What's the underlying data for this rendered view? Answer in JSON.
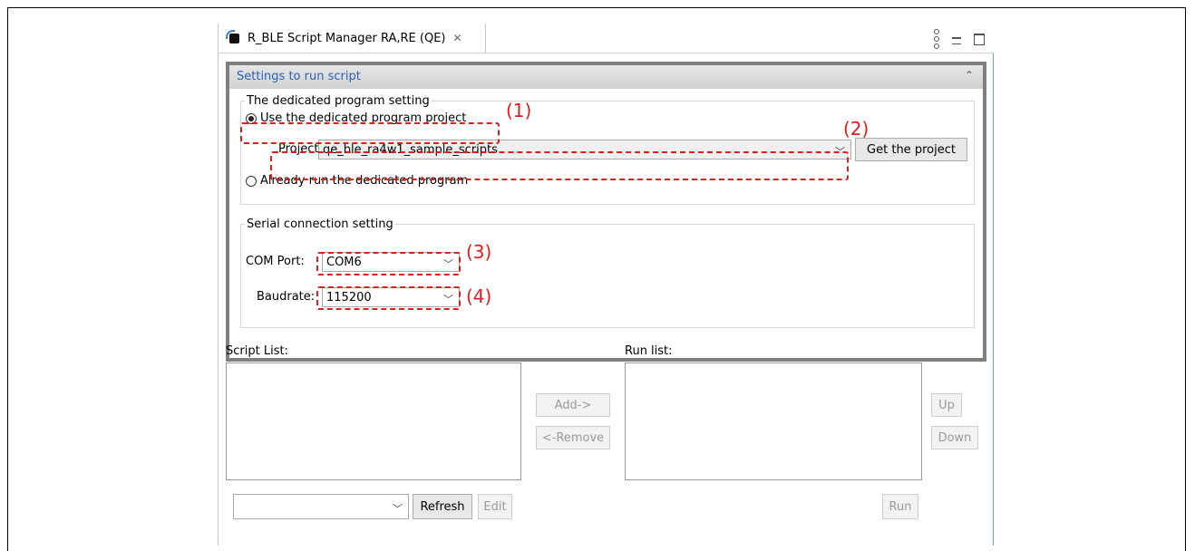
{
  "tab": {
    "title": "R_BLE Script Manager RA,RE (QE)",
    "close_glyph": "✕"
  },
  "section": {
    "title": "Settings to run script",
    "collapse_glyph": "⌃"
  },
  "dedicated": {
    "legend": "The dedicated program setting",
    "option_use": "Use the dedicated program project",
    "project_label": "Project",
    "project_value": "qe_ble_ra4w1_sample_scripts",
    "get_project_button": "Get the project",
    "option_already": "Already run the dedicated program"
  },
  "serial": {
    "legend": "Serial connection setting",
    "com_label": "COM Port:",
    "com_value": "COM6",
    "baud_label": "Baudrate:",
    "baud_value": "115200"
  },
  "script_list": {
    "label": "Script List:"
  },
  "run_list": {
    "label": "Run list:"
  },
  "buttons": {
    "add": "Add->",
    "remove": "<-Remove",
    "up": "Up",
    "down": "Down",
    "refresh": "Refresh",
    "edit": "Edit",
    "run": "Run"
  },
  "annotations": {
    "a1": "(1)",
    "a2": "(2)",
    "a3": "(3)",
    "a4": "(4)"
  },
  "colors": {
    "annotation_red": "#e31b1b",
    "section_title_blue": "#2960b2"
  }
}
